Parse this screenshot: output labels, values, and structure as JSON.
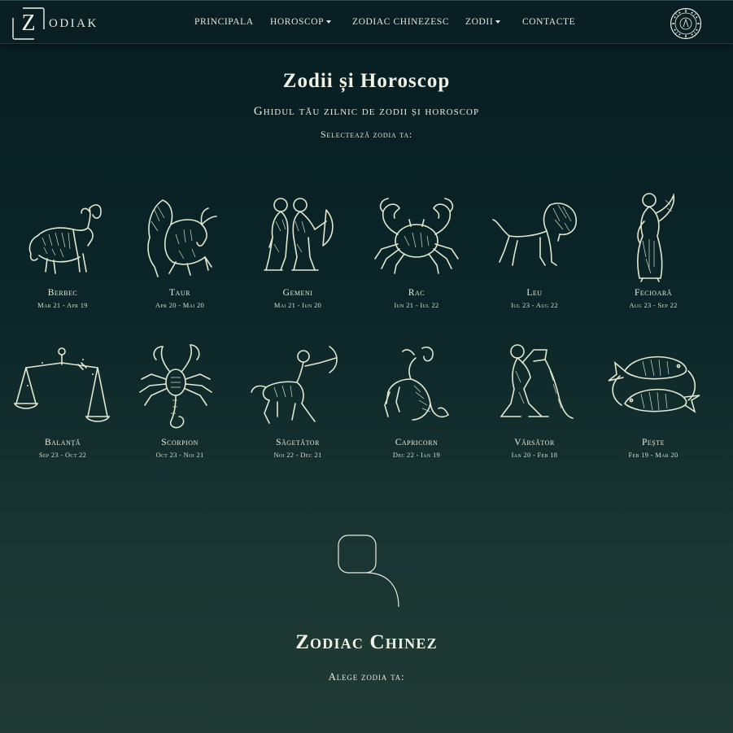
{
  "brand": {
    "logo_letter": "Z",
    "logo_text": "ODIAK"
  },
  "nav": {
    "items": [
      {
        "label": "PRINCIPALA",
        "dropdown": false
      },
      {
        "label": "HOROSCOP",
        "dropdown": true
      },
      {
        "label": "ZODIAC CHINEZESC",
        "dropdown": false
      },
      {
        "label": "ZODII",
        "dropdown": true
      },
      {
        "label": "CONTACTE",
        "dropdown": false
      }
    ],
    "wheel_icon": "zodiac-wheel-icon"
  },
  "hero": {
    "title": "Zodii și Horoscop",
    "subtitle": "Ghidul tău zilnic de zodii și horoscop",
    "select_prompt": "Selectează zodia ta:"
  },
  "signs": [
    {
      "name": "Berbec",
      "dates": "Mar 21 - Apr 19",
      "icon": "ram-icon"
    },
    {
      "name": "Taur",
      "dates": "Apr 20 - Mai 20",
      "icon": "bull-icon"
    },
    {
      "name": "Gemeni",
      "dates": "Mai 21 - Iun 20",
      "icon": "twins-icon"
    },
    {
      "name": "Rac",
      "dates": "Iun 21 - Iul 22",
      "icon": "crab-icon"
    },
    {
      "name": "Leu",
      "dates": "Iul 23 - Aug 22",
      "icon": "lion-icon"
    },
    {
      "name": "Fecioară",
      "dates": "Aug 23 - Sep 22",
      "icon": "maiden-icon"
    },
    {
      "name": "Balanță",
      "dates": "Sep 23 - Oct 22",
      "icon": "scales-icon"
    },
    {
      "name": "Scorpion",
      "dates": "Oct 23 - Noi 21",
      "icon": "scorpion-icon"
    },
    {
      "name": "Săgetător",
      "dates": "Noi 22 - Dec 21",
      "icon": "archer-icon"
    },
    {
      "name": "Capricorn",
      "dates": "Dec 22 - Ian 19",
      "icon": "sea-goat-icon"
    },
    {
      "name": "Vărsător",
      "dates": "Ian 20 - Feb 18",
      "icon": "water-bearer-icon"
    },
    {
      "name": "Pește",
      "dates": "Feb 19 - Mar 20",
      "icon": "fish-icon"
    }
  ],
  "chinese": {
    "title": "Zodiac Chinez",
    "select_prompt": "Alege zodia ta:"
  },
  "colors": {
    "background_top": "#071d22",
    "background_bottom": "#213a34",
    "ink": "#e8ecdc"
  }
}
